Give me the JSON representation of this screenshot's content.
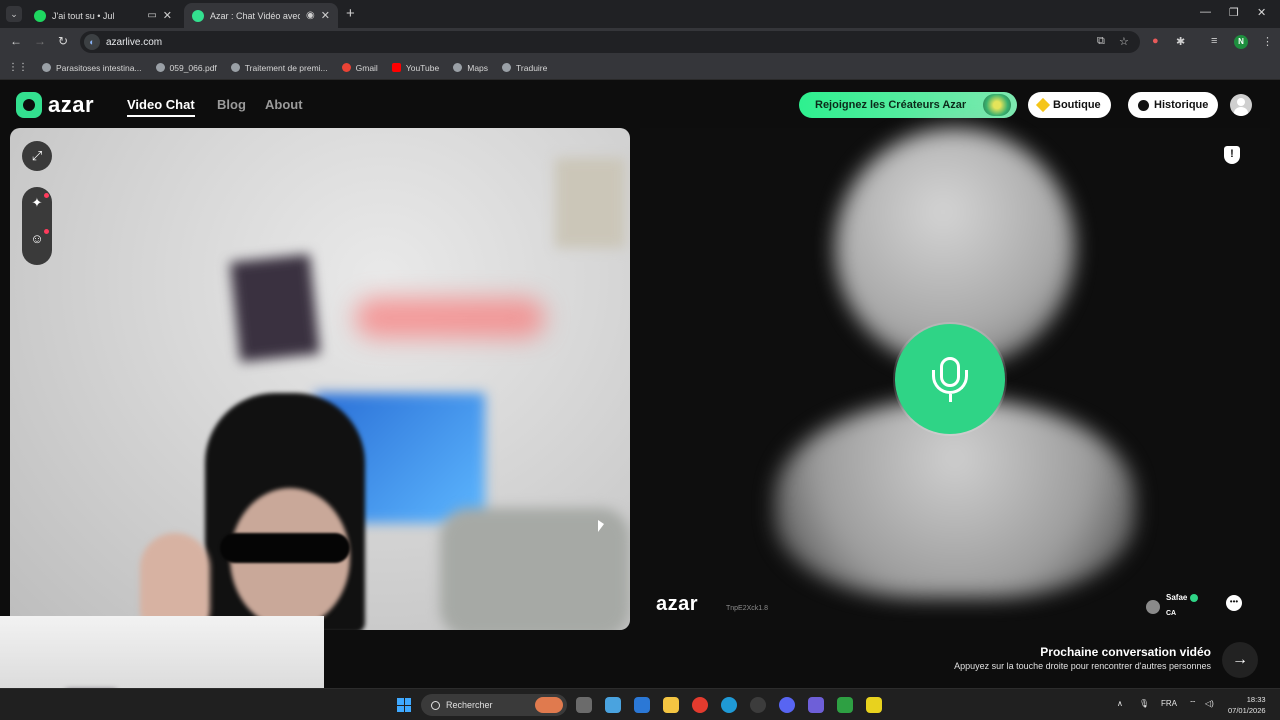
{
  "browser": {
    "tabs": [
      {
        "title": "J'ai tout su • Jul",
        "active": false
      },
      {
        "title": "Azar : Chat Vidéo avec de n",
        "active": true
      }
    ],
    "url": "azarlive.com",
    "bookmarks": [
      "Parasitoses intestina...",
      "059_066.pdf",
      "Traitement de premi...",
      "Gmail",
      "YouTube",
      "Maps",
      "Traduire"
    ],
    "profile_initial": "N"
  },
  "app": {
    "logo": "azar",
    "nav": [
      "Video Chat",
      "Blog",
      "About"
    ],
    "creators_button": "Rejoignez les Créateurs Azar",
    "shop_button": "Boutique",
    "history_button": "Historique"
  },
  "remote": {
    "watermark": "azar",
    "watermark_id": "TnpE2Xck1.8",
    "peer_name": "Safae",
    "peer_country": "CA"
  },
  "next": {
    "title": "Prochaine conversation vidéo",
    "subtitle": "Appuyez sur la touche droite pour rencontrer d'autres personnes"
  },
  "taskbar": {
    "search_label": "Rechercher",
    "language": "FRA",
    "time": "18:33",
    "date": "07/01/2026"
  },
  "colors": {
    "accent": "#2fd486",
    "page_bg": "#0d0d0d"
  }
}
